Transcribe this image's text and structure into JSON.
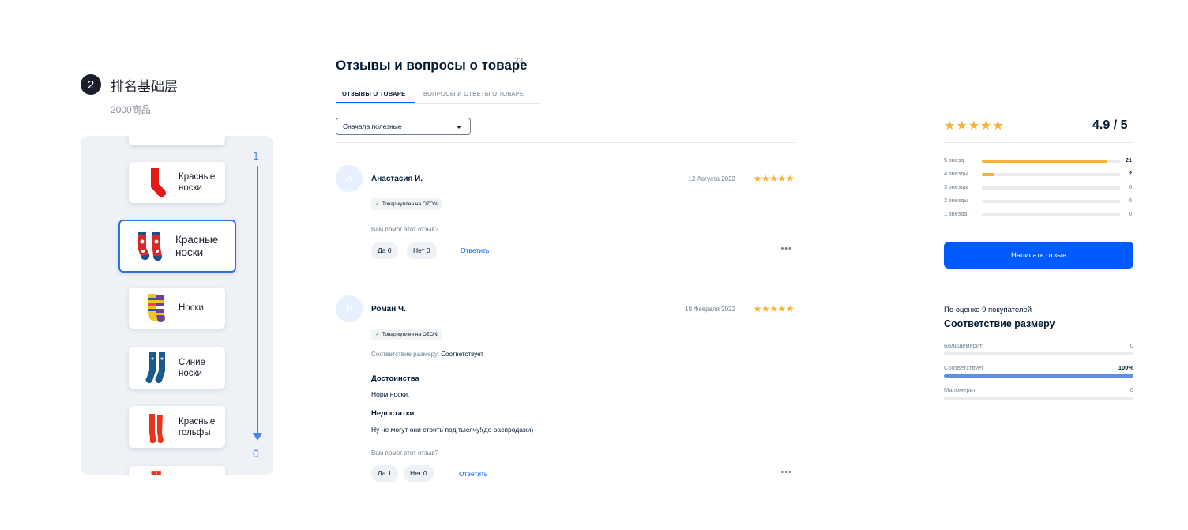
{
  "step": {
    "number": "2",
    "title": "排名基础层",
    "subtitle": "2000商品"
  },
  "rank_panel": {
    "scale_top": "1",
    "scale_bottom": "0",
    "items": [
      {
        "label": "",
        "icon": "sock-icon"
      },
      {
        "label": "Красные\nноски",
        "icon": "red-sock-icon"
      },
      {
        "label": "Красные\nноски",
        "icon": "patterned-socks-icon",
        "selected": true
      },
      {
        "label": "Носки",
        "icon": "striped-socks-icon"
      },
      {
        "label": "Синие\nноски",
        "icon": "blue-socks-icon"
      },
      {
        "label": "Красные\nгольфы",
        "icon": "red-knee-socks-icon"
      },
      {
        "label": "",
        "icon": "sock-icon"
      }
    ]
  },
  "reviews_section": {
    "title": "Отзывы и вопросы о товаре",
    "count": "23",
    "tabs": [
      "ОТЗЫВЫ О ТОВАРЕ",
      "ВОПРОСЫ И ОТВЕТЫ О ТОВАРЕ"
    ],
    "sort_value": "Сначала полезные"
  },
  "reviews": [
    {
      "avatar": "А",
      "name": "Анастасия И.",
      "date": "12 Августа 2022",
      "rating": 5,
      "stars": "★★★★★",
      "badge": "Товар куплен на OZON",
      "helpful_q": "Вам помог этот отзыв?",
      "yes": "Да 0",
      "no": "Нет 0",
      "reply": "Ответить"
    },
    {
      "avatar": "Р",
      "name": "Роман Ч.",
      "date": "19 Февраля 2022",
      "rating": 5,
      "stars": "★★★★★",
      "badge": "Товар куплен на OZON",
      "fit_label": "Соответствие размеру:",
      "fit_value": "Соответствует",
      "pros_title": "Достоинства",
      "pros_text": "Норм носки.",
      "cons_title": "Недостатки",
      "cons_text": "Ну не могут они стоить под тысячу!(до распродажи)",
      "helpful_q": "Вам помог этот отзыв?",
      "yes": "Да 1",
      "no": "Нет 0",
      "reply": "Ответить"
    }
  ],
  "summary": {
    "stars": "★★★★★",
    "score": "4.9 / 5",
    "distribution": [
      {
        "label": "5 звезд",
        "count": "21",
        "fraction": 0.91
      },
      {
        "label": "4 звезды",
        "count": "2",
        "fraction": 0.09
      },
      {
        "label": "3 звезды",
        "count": "0",
        "fraction": 0
      },
      {
        "label": "2 звезды",
        "count": "0",
        "fraction": 0
      },
      {
        "label": "1 звезда",
        "count": "0",
        "fraction": 0
      }
    ],
    "write_button": "Написать отзыв"
  },
  "size_fit": {
    "subtitle": "По оценке 9 покупателей",
    "title": "Соответствие размеру",
    "rows": [
      {
        "label": "Большемерит",
        "value": "0",
        "fraction": 0
      },
      {
        "label": "Соответствует",
        "value": "100%",
        "fraction": 1
      },
      {
        "label": "Маломерит",
        "value": "0",
        "fraction": 0
      }
    ]
  },
  "colors": {
    "accent": "#005bff",
    "star": "#f6b237",
    "scale": "#4a86e8",
    "selected_border": "#2b74e2"
  }
}
